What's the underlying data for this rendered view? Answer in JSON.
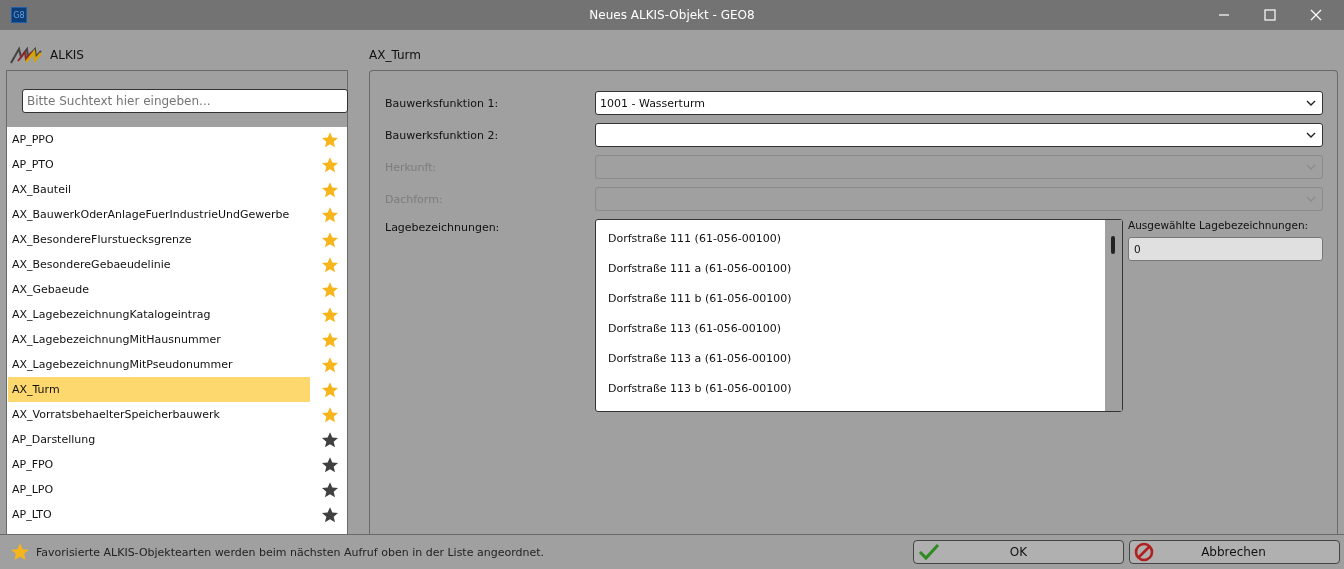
{
  "window": {
    "title": "Neues ALKIS-Objekt - GEO8",
    "app_icon": "G8"
  },
  "sidebar": {
    "title": "ALKIS",
    "search": {
      "placeholder": "Bitte Suchtext hier eingeben..."
    },
    "items": [
      {
        "label": "AP_PPO",
        "favorite": true,
        "selected": false
      },
      {
        "label": "AP_PTO",
        "favorite": true,
        "selected": false
      },
      {
        "label": "AX_Bauteil",
        "favorite": true,
        "selected": false
      },
      {
        "label": "AX_BauwerkOderAnlageFuerIndustrieUndGewerbe",
        "favorite": true,
        "selected": false
      },
      {
        "label": "AX_BesondereFlurstuecksgrenze",
        "favorite": true,
        "selected": false
      },
      {
        "label": "AX_BesondereGebaeudelinie",
        "favorite": true,
        "selected": false
      },
      {
        "label": "AX_Gebaeude",
        "favorite": true,
        "selected": false
      },
      {
        "label": "AX_LagebezeichnungKatalogeintrag",
        "favorite": true,
        "selected": false
      },
      {
        "label": "AX_LagebezeichnungMitHausnummer",
        "favorite": true,
        "selected": false
      },
      {
        "label": "AX_LagebezeichnungMitPseudonummer",
        "favorite": true,
        "selected": false
      },
      {
        "label": "AX_Turm",
        "favorite": true,
        "selected": true
      },
      {
        "label": "AX_VorratsbehaelterSpeicherbauwerk",
        "favorite": true,
        "selected": false
      },
      {
        "label": "AP_Darstellung",
        "favorite": false,
        "selected": false
      },
      {
        "label": "AP_FPO",
        "favorite": false,
        "selected": false
      },
      {
        "label": "AP_LPO",
        "favorite": false,
        "selected": false
      },
      {
        "label": "AP_LTO",
        "favorite": false,
        "selected": false
      }
    ]
  },
  "form": {
    "title": "AX_Turm",
    "fields": [
      {
        "label": "Bauwerksfunktion 1:",
        "value": "1001 - Wasserturm",
        "disabled": false
      },
      {
        "label": "Bauwerksfunktion 2:",
        "disabled": false
      },
      {
        "label": "Herkunft:",
        "disabled": true
      },
      {
        "label": "Dachform:",
        "disabled": true
      }
    ],
    "lage": {
      "label": "Lagebezeichnungen:",
      "items": [
        "Dorfstraße 111 (61-056-00100)",
        "Dorfstraße 111 a (61-056-00100)",
        "Dorfstraße 111 b (61-056-00100)",
        "Dorfstraße 113 (61-056-00100)",
        "Dorfstraße 113 a (61-056-00100)",
        "Dorfstraße 113 b (61-056-00100)"
      ]
    },
    "selected_count": {
      "label": "Ausgewählte Lagebezeichnungen:",
      "value": "0"
    }
  },
  "footer": {
    "hint": "Favorisierte ALKIS-Objektearten werden beim nächsten Aufruf oben in der Liste angeordnet.",
    "buttons": [
      {
        "label": "OK",
        "kind": "ok"
      },
      {
        "label": "Abbrechen",
        "kind": "cancel"
      }
    ]
  }
}
